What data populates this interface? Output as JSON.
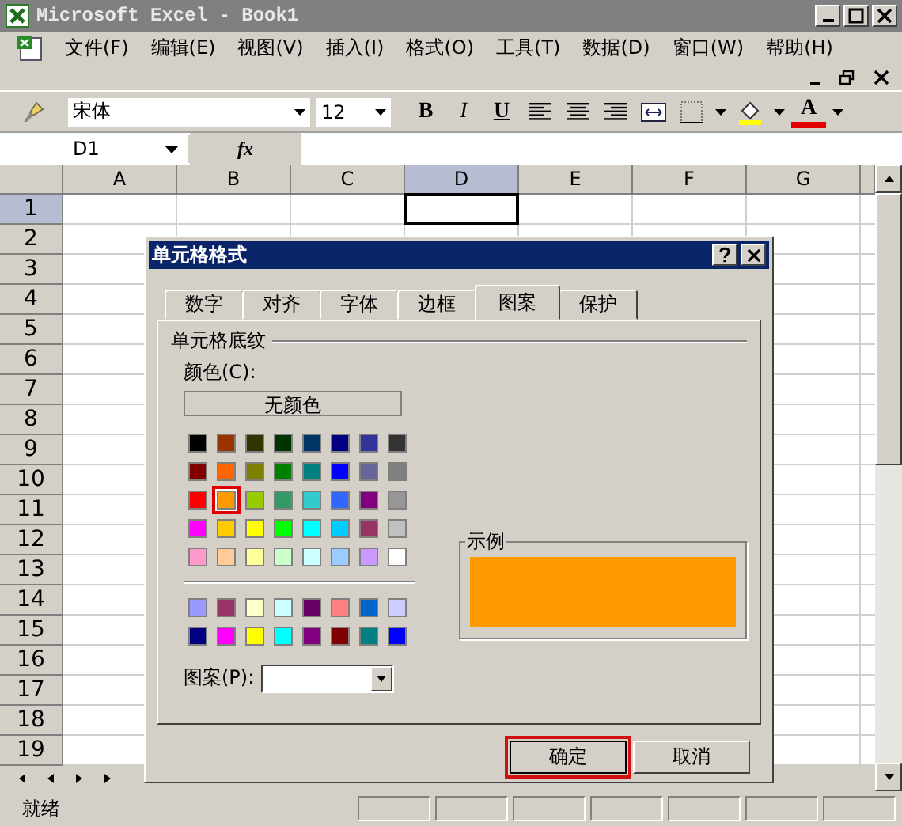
{
  "window": {
    "title": "Microsoft Excel - Book1"
  },
  "menu": [
    "文件(F)",
    "编辑(E)",
    "视图(V)",
    "插入(I)",
    "格式(O)",
    "工具(T)",
    "数据(D)",
    "窗口(W)",
    "帮助(H)"
  ],
  "toolbar": {
    "font": "宋体",
    "size": "12",
    "bold": "B",
    "italic": "I",
    "underline": "U",
    "font_color": "A"
  },
  "formula_bar": {
    "name_box": "D1",
    "fx": "fx"
  },
  "columns": [
    {
      "label": "A",
      "selected": false
    },
    {
      "label": "B",
      "selected": false
    },
    {
      "label": "C",
      "selected": false
    },
    {
      "label": "D",
      "selected": true
    },
    {
      "label": "E",
      "selected": false
    },
    {
      "label": "F",
      "selected": false
    },
    {
      "label": "G",
      "selected": false
    }
  ],
  "rows": [
    {
      "label": "1",
      "selected": true
    },
    {
      "label": "2",
      "selected": false
    },
    {
      "label": "3",
      "selected": false
    },
    {
      "label": "4",
      "selected": false
    },
    {
      "label": "5",
      "selected": false
    },
    {
      "label": "6",
      "selected": false
    },
    {
      "label": "7",
      "selected": false
    },
    {
      "label": "8",
      "selected": false
    },
    {
      "label": "9",
      "selected": false
    },
    {
      "label": "10",
      "selected": false
    },
    {
      "label": "11",
      "selected": false
    },
    {
      "label": "12",
      "selected": false
    },
    {
      "label": "13",
      "selected": false
    },
    {
      "label": "14",
      "selected": false
    },
    {
      "label": "15",
      "selected": false
    },
    {
      "label": "16",
      "selected": false
    },
    {
      "label": "17",
      "selected": false
    },
    {
      "label": "18",
      "selected": false
    },
    {
      "label": "19",
      "selected": false
    }
  ],
  "dialog": {
    "title": "单元格格式",
    "tabs": [
      {
        "label": "数字",
        "selected": false
      },
      {
        "label": "对齐",
        "selected": false
      },
      {
        "label": "字体",
        "selected": false
      },
      {
        "label": "边框",
        "selected": false
      },
      {
        "label": "图案",
        "selected": true
      },
      {
        "label": "保护",
        "selected": false
      }
    ],
    "section": "单元格底纹",
    "color_label": "颜色(C):",
    "no_color": "无颜色",
    "palette": [
      {
        "color": "#000000",
        "selected": false
      },
      {
        "color": "#993300",
        "selected": false
      },
      {
        "color": "#333300",
        "selected": false
      },
      {
        "color": "#003300",
        "selected": false
      },
      {
        "color": "#003366",
        "selected": false
      },
      {
        "color": "#000080",
        "selected": false
      },
      {
        "color": "#333399",
        "selected": false
      },
      {
        "color": "#333333",
        "selected": false
      },
      {
        "color": "#800000",
        "selected": false
      },
      {
        "color": "#ff6600",
        "selected": false
      },
      {
        "color": "#808000",
        "selected": false
      },
      {
        "color": "#008000",
        "selected": false
      },
      {
        "color": "#008080",
        "selected": false
      },
      {
        "color": "#0000ff",
        "selected": false
      },
      {
        "color": "#666699",
        "selected": false
      },
      {
        "color": "#808080",
        "selected": false
      },
      {
        "color": "#ff0000",
        "selected": false
      },
      {
        "color": "#ff9900",
        "selected": true
      },
      {
        "color": "#99cc00",
        "selected": false
      },
      {
        "color": "#339966",
        "selected": false
      },
      {
        "color": "#33cccc",
        "selected": false
      },
      {
        "color": "#3366ff",
        "selected": false
      },
      {
        "color": "#800080",
        "selected": false
      },
      {
        "color": "#969696",
        "selected": false
      },
      {
        "color": "#ff00ff",
        "selected": false
      },
      {
        "color": "#ffcc00",
        "selected": false
      },
      {
        "color": "#ffff00",
        "selected": false
      },
      {
        "color": "#00ff00",
        "selected": false
      },
      {
        "color": "#00ffff",
        "selected": false
      },
      {
        "color": "#00ccff",
        "selected": false
      },
      {
        "color": "#993366",
        "selected": false
      },
      {
        "color": "#c0c0c0",
        "selected": false
      },
      {
        "color": "#ff99cc",
        "selected": false
      },
      {
        "color": "#ffcc99",
        "selected": false
      },
      {
        "color": "#ffff99",
        "selected": false
      },
      {
        "color": "#ccffcc",
        "selected": false
      },
      {
        "color": "#ccffff",
        "selected": false
      },
      {
        "color": "#99ccff",
        "selected": false
      },
      {
        "color": "#cc99ff",
        "selected": false
      },
      {
        "color": "#ffffff",
        "selected": false
      }
    ],
    "palette_extra": [
      {
        "color": "#9999ff",
        "selected": false
      },
      {
        "color": "#993366",
        "selected": false
      },
      {
        "color": "#ffffcc",
        "selected": false
      },
      {
        "color": "#ccffff",
        "selected": false
      },
      {
        "color": "#660066",
        "selected": false
      },
      {
        "color": "#ff8080",
        "selected": false
      },
      {
        "color": "#0066cc",
        "selected": false
      },
      {
        "color": "#ccccff",
        "selected": false
      },
      {
        "color": "#000080",
        "selected": false
      },
      {
        "color": "#ff00ff",
        "selected": false
      },
      {
        "color": "#ffff00",
        "selected": false
      },
      {
        "color": "#00ffff",
        "selected": false
      },
      {
        "color": "#800080",
        "selected": false
      },
      {
        "color": "#800000",
        "selected": false
      },
      {
        "color": "#008080",
        "selected": false
      },
      {
        "color": "#0000ff",
        "selected": false
      }
    ],
    "pattern_label": "图案(P):",
    "sample_label": "示例",
    "buttons": [
      {
        "label": "确定",
        "default": true
      },
      {
        "label": "取消",
        "default": false
      }
    ]
  },
  "status": "就绪"
}
